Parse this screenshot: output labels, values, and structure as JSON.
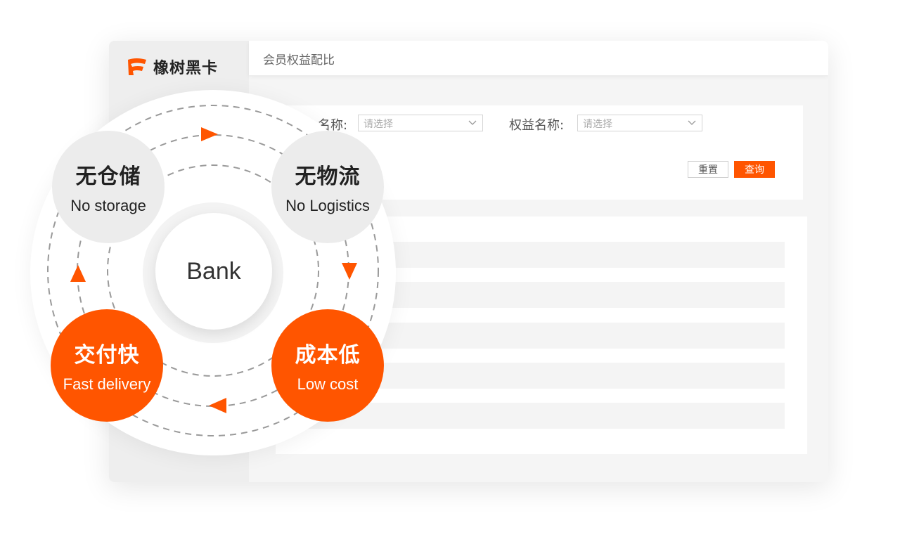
{
  "brand": {
    "name": "橡树黑卡",
    "logo_icon": "brand-flag-icon",
    "accent": "#ff5500"
  },
  "header": {
    "title": "会员权益配比"
  },
  "filters": {
    "field1": {
      "label": "名称:",
      "placeholder": "请选择"
    },
    "field2": {
      "label": "权益名称:",
      "placeholder": "请选择"
    },
    "reset_label": "重置",
    "query_label": "查询"
  },
  "diagram": {
    "center": "Bank",
    "nodes": [
      {
        "cn": "无仓储",
        "en": "No storage",
        "style": "gray"
      },
      {
        "cn": "无物流",
        "en": "No Logistics",
        "style": "gray"
      },
      {
        "cn": "成本低",
        "en": "Low cost",
        "style": "orange"
      },
      {
        "cn": "交付快",
        "en": "Fast delivery",
        "style": "orange"
      }
    ],
    "colors": {
      "accent": "#ff5500",
      "gray_node": "#ececec",
      "ring": "#9a9a9a"
    }
  }
}
